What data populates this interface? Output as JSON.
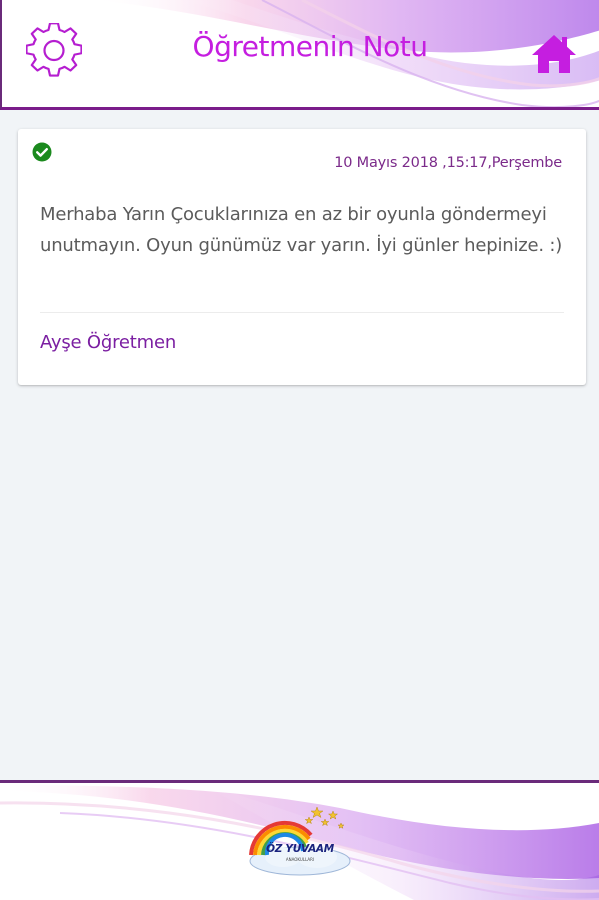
{
  "header": {
    "title": "Öğretmenin Notu",
    "settings_icon": "gear-icon",
    "home_icon": "home-icon"
  },
  "note": {
    "status_icon": "check-circle-icon",
    "date": "10 Mayıs 2018 ,15:17,Perşembe",
    "body": "Merhaba Yarın Çocuklarınıza en az bir oyunla göndermeyi unutmayın. Oyun günümüz var yarın. İyi günler hepinize. :)",
    "author": "Ayşe Öğretmen"
  },
  "footer": {
    "logo_text": "ÖZ YUVAAM",
    "logo_subtext": "ANAOKULLARI"
  },
  "colors": {
    "accent": "#c51ee0",
    "purple_text": "#7b1fa2",
    "date_text": "#7b2a8a",
    "body_text": "#5b5b5b",
    "background": "#f1f4f7",
    "check_green": "#1b8a1e"
  }
}
